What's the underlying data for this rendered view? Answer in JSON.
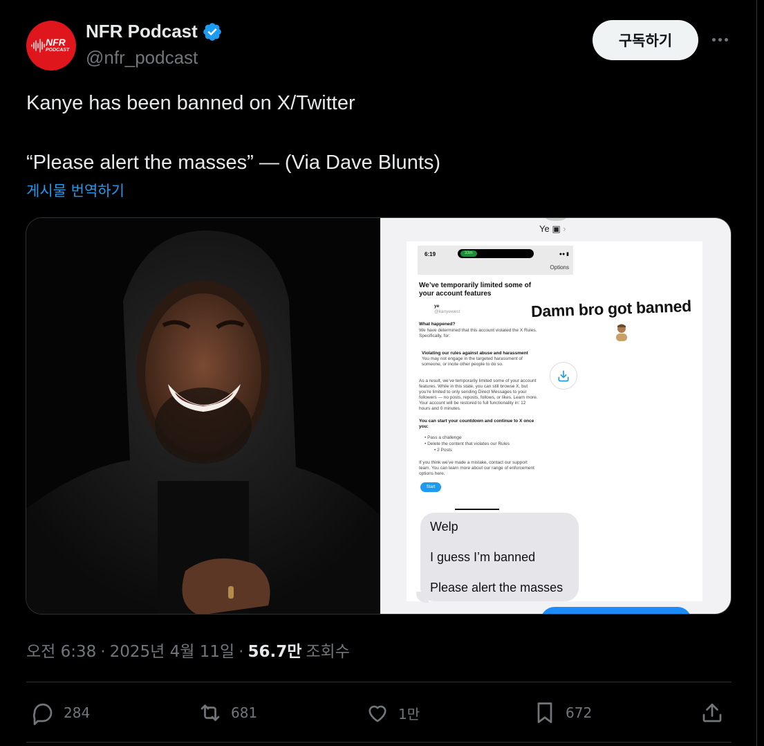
{
  "author": {
    "display_name": "NFR Podcast",
    "handle": "@nfr_podcast",
    "verified": true,
    "avatar_logo_line1": "NFR",
    "avatar_logo_line2": "PODCAST",
    "avatar_color": "#e0161d"
  },
  "header": {
    "subscribe_label": "구독하기",
    "more_icon": "more-icon"
  },
  "tweet": {
    "text_line1": "Kanye has been banned on X/Twitter",
    "text_line2": "“Please alert the masses” — (Via Dave Blunts)",
    "translate_label": "게시물 번역하기"
  },
  "media": {
    "right_panel": {
      "header_name": "Ye",
      "phone_time": "6:19",
      "phone_pill": "33m",
      "options_label": "Options",
      "heading": "We’ve temporarily limited some of your account features",
      "account_name": "ye",
      "account_handle": "@kanyewest",
      "what_happened_label": "What happened?",
      "what_happened_text": "We have determined that this account violated the X Rules. Specifically, for:",
      "violation_title": "Violating our rules against abuse and harassment",
      "violation_text": "You may not engage in the targeted harassment of someone, or incite other people to do so.",
      "result_text": "As a result, we’ve temporarily limited some of your account features. While in this state, you can still browse X, but you’re limited to only sending Direct Messages to your followers — no posts, reposts, follows, or likes. Learn more. Your account will be restored to full functionality in: 12 hours and 0 minutes.",
      "countdown_text": "You can start your countdown and continue to X once you:",
      "bullet_1": "• Pass a challenge",
      "bullet_2": "• Delete the content that violates our Rules",
      "bullet_3": "• 2 Posts",
      "mistake_text": "If you think we’ve made a mistake, contact our support team. You can learn more about our range of enforcement options here.",
      "start_label": "Start",
      "caption": "Damn bro got banned",
      "imessage_lines": [
        "Welp",
        "I guess I’m banned",
        "Please alert the masses"
      ]
    }
  },
  "meta": {
    "time": "오전 6:38",
    "separator": "·",
    "date": "2025년 4월 11일",
    "views_count": "56.7만",
    "views_label": "조회수"
  },
  "actions": {
    "replies": "284",
    "reposts": "681",
    "likes": "1만",
    "bookmarks": "672"
  },
  "colors": {
    "background": "#000000",
    "text": "#e7e9ea",
    "muted": "#71767b",
    "link": "#1d9bf0",
    "divider": "#2f3336"
  }
}
